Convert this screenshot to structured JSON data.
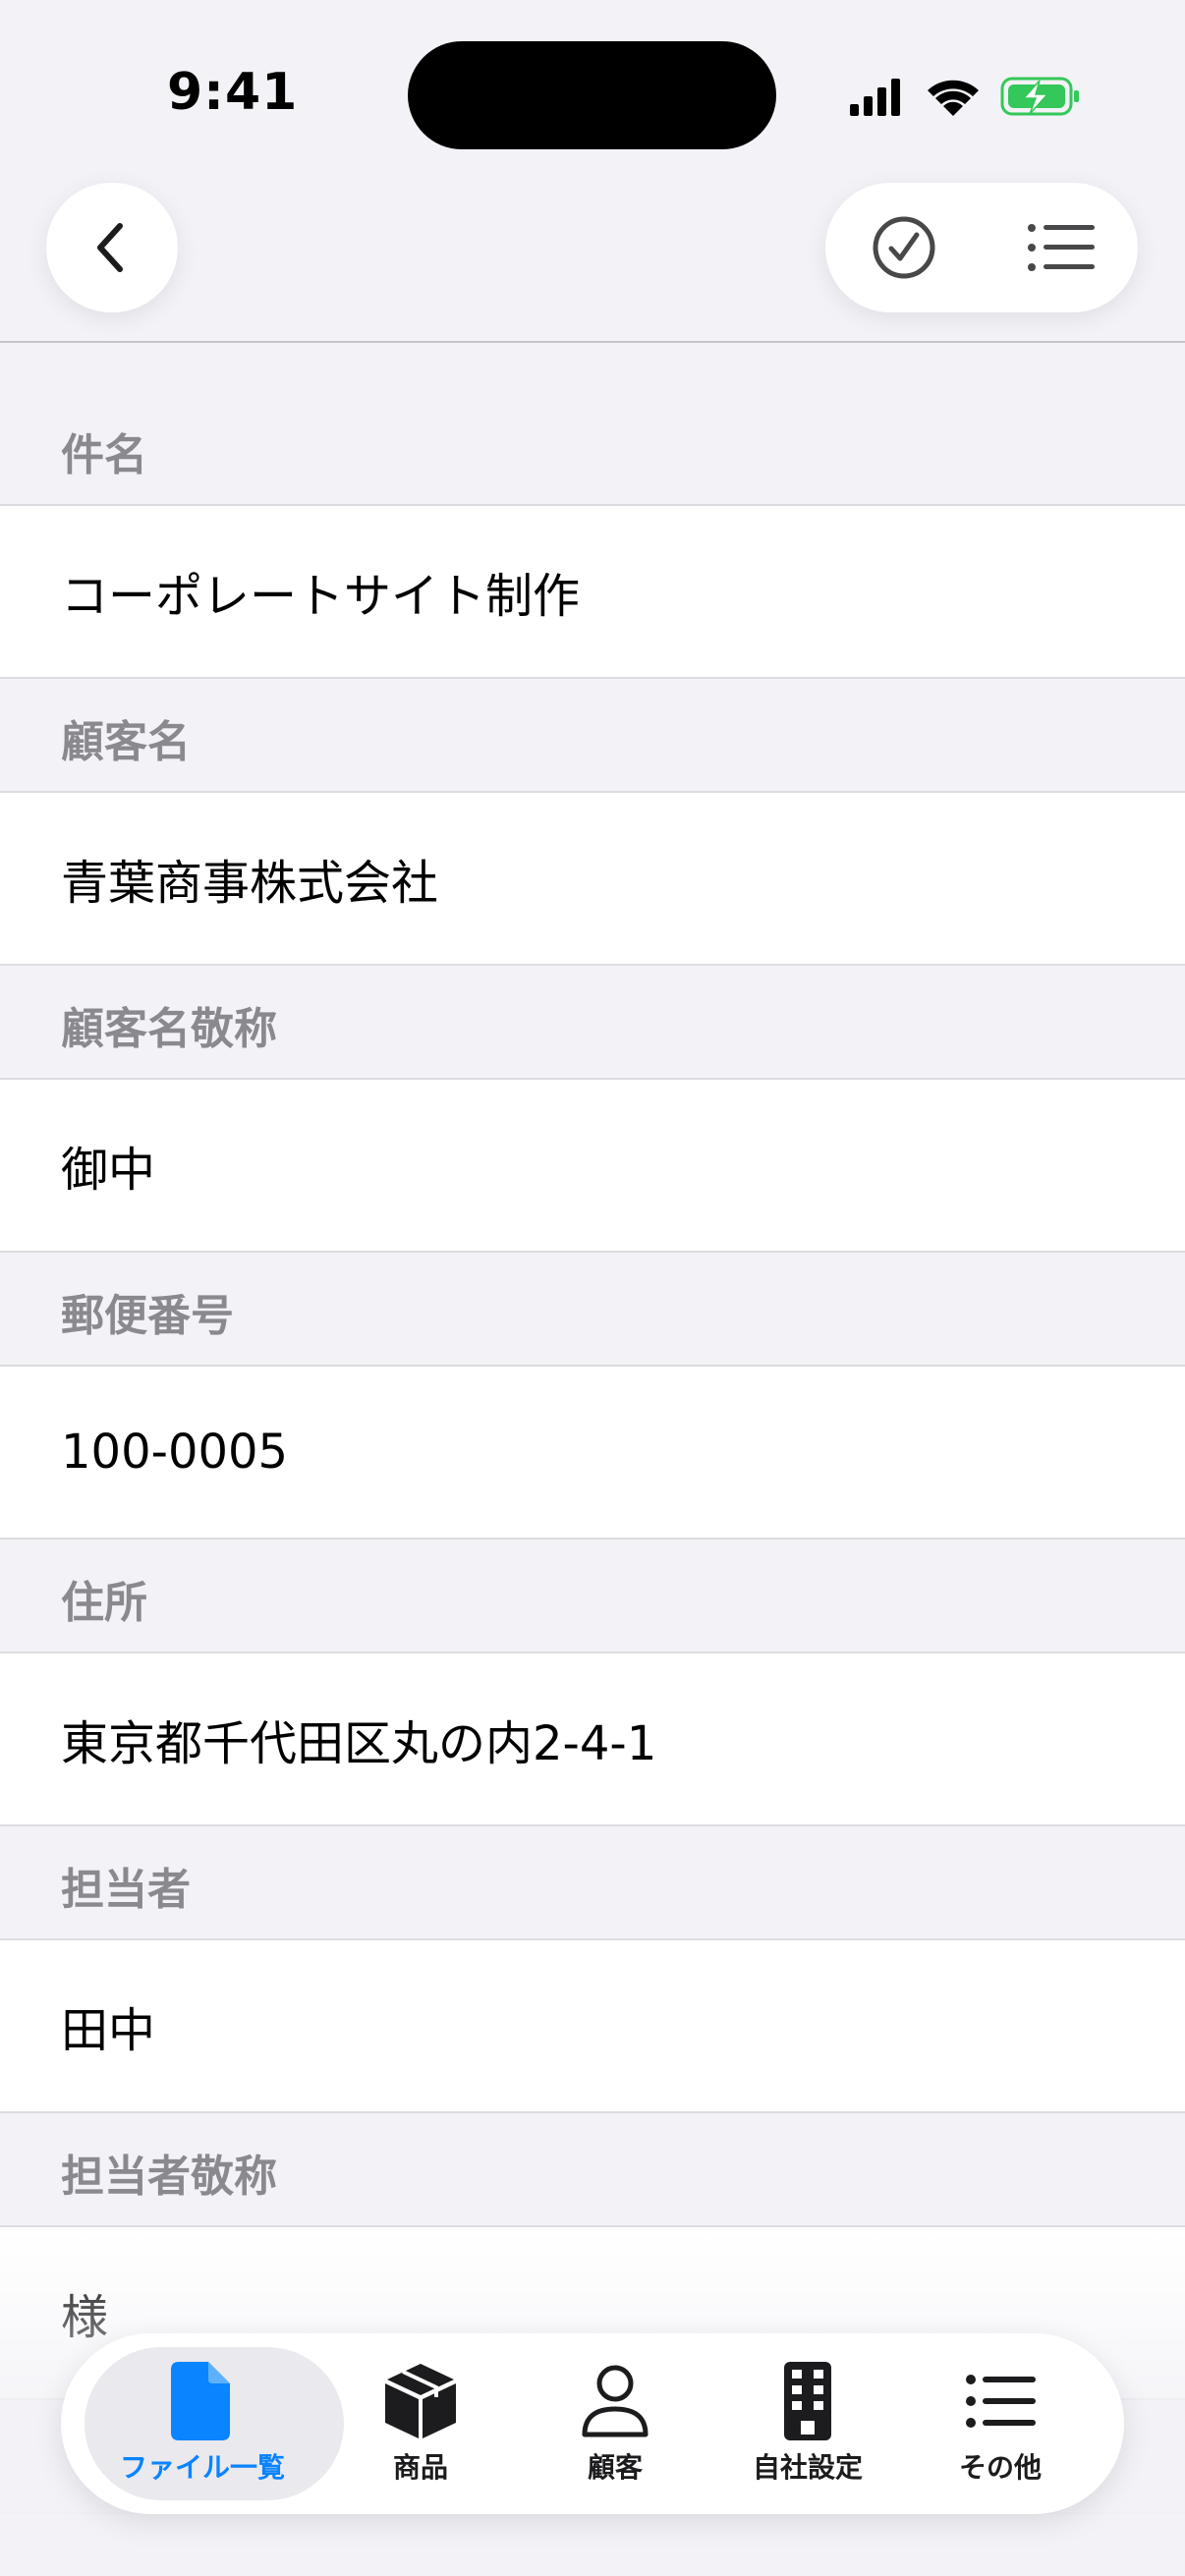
{
  "status_bar": {
    "time": "9:41"
  },
  "nav": {
    "back_icon": "chevron-left-icon",
    "actions": [
      {
        "icon": "checkmark-circle-icon"
      },
      {
        "icon": "list-icon"
      }
    ]
  },
  "form": {
    "fields": [
      {
        "label": "件名",
        "value": "コーポレートサイト制作"
      },
      {
        "label": "顧客名",
        "value": "青葉商事株式会社"
      },
      {
        "label": "顧客名敬称",
        "value": "御中"
      },
      {
        "label": "郵便番号",
        "value": "100-0005"
      },
      {
        "label": "住所",
        "value": "東京都千代田区丸の内2-4-1"
      },
      {
        "label": "担当者",
        "value": "田中"
      },
      {
        "label": "担当者敬称",
        "value": "様"
      }
    ]
  },
  "tab_bar": {
    "active_color": "#0a84ff",
    "tabs": [
      {
        "label": "ファイル一覧",
        "icon": "document-icon",
        "active": true
      },
      {
        "label": "商品",
        "icon": "box-icon",
        "active": false
      },
      {
        "label": "顧客",
        "icon": "person-icon",
        "active": false
      },
      {
        "label": "自社設定",
        "icon": "building-icon",
        "active": false
      },
      {
        "label": "その他",
        "icon": "list-icon",
        "active": false
      }
    ]
  }
}
